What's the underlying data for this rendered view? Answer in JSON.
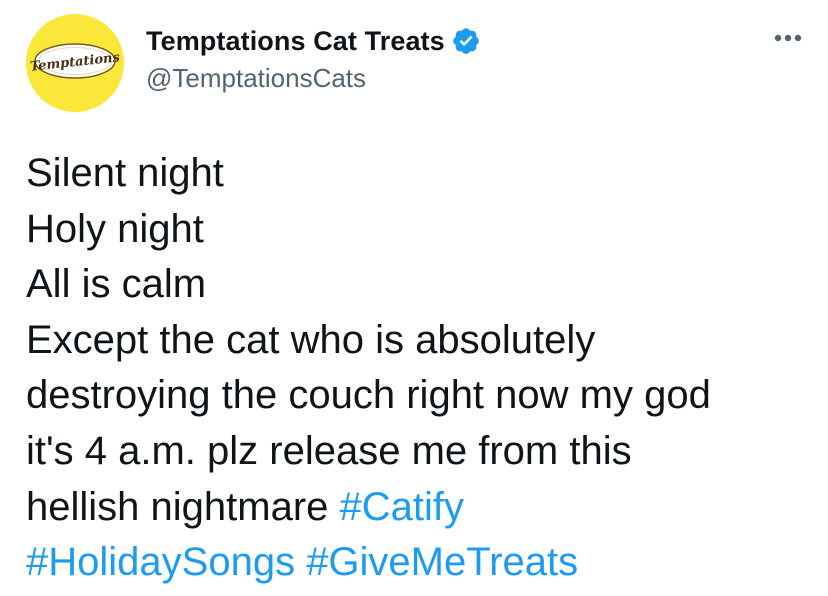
{
  "author": {
    "display_name": "Temptations Cat Treats",
    "handle": "@TemptationsCats",
    "avatar_text": "Temptations",
    "verified": true,
    "avatar_color": "#fbe63a",
    "verified_color": "#1d9bf0"
  },
  "more_menu_icon": "more-horizontal-icon",
  "tweet": {
    "lines": [
      "Silent night",
      "Holy night",
      "All is calm",
      "Except the cat who is absolutely",
      "destroying the couch right now my god",
      "it's 4 a.m. plz release me from this",
      "hellish nightmare "
    ],
    "hashtags": [
      "#Catify",
      "#HolidaySongs",
      "#GiveMeTreats"
    ],
    "hashtag_color": "#1d9bf0"
  }
}
